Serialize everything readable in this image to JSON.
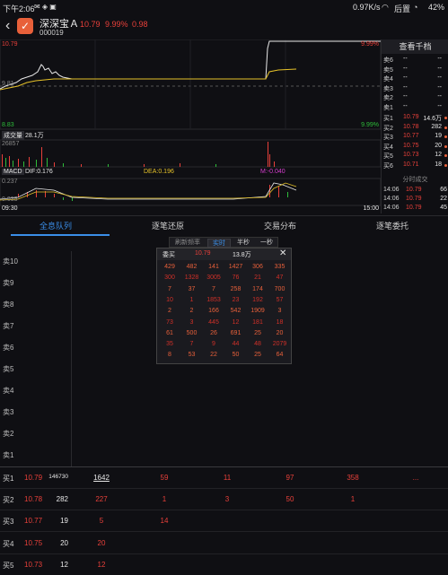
{
  "status_bar": {
    "time": "下午2:06",
    "speed": "0.97K/s",
    "carrier": "后置",
    "battery": "42%"
  },
  "header": {
    "stock_name": "深深宝Ａ",
    "stock_code": "000019",
    "price": "10.79",
    "change_pct": "9.99%",
    "change": "0.98"
  },
  "chart": {
    "price_high": "10.79",
    "pct_high": "9.99%",
    "price_mid": "9.81",
    "price_low": "8.83",
    "pct_low": "9.99%",
    "volume_label": "成交量",
    "volume_value": "28.1万",
    "volume_max": "26857",
    "macd_label": "MACD",
    "dif": "DIF:0.176",
    "dea": "DEA:0.196",
    "m": "M:-0.040",
    "macd_top": "0.237",
    "macd_bottom": "0.035",
    "time_start": "09:30",
    "time_end": "15:00"
  },
  "order_book": {
    "title": "查看千档",
    "sells": [
      {
        "label": "卖6",
        "price": "--",
        "vol": "--"
      },
      {
        "label": "卖5",
        "price": "--",
        "vol": "--"
      },
      {
        "label": "卖4",
        "price": "--",
        "vol": "--"
      },
      {
        "label": "卖3",
        "price": "--",
        "vol": "--"
      },
      {
        "label": "卖2",
        "price": "--",
        "vol": "--"
      },
      {
        "label": "卖1",
        "price": "--",
        "vol": "--"
      }
    ],
    "buys": [
      {
        "label": "买1",
        "price": "10.79",
        "vol": "14.6万"
      },
      {
        "label": "买2",
        "price": "10.78",
        "vol": "282"
      },
      {
        "label": "买3",
        "price": "10.77",
        "vol": "19"
      },
      {
        "label": "买4",
        "price": "10.75",
        "vol": "20"
      },
      {
        "label": "买5",
        "price": "10.73",
        "vol": "12"
      },
      {
        "label": "买6",
        "price": "10.71",
        "vol": "18"
      }
    ],
    "trades_title": "分时成交",
    "trades": [
      {
        "time": "14:06",
        "price": "10.79",
        "vol": "66"
      },
      {
        "time": "14:06",
        "price": "10.79",
        "vol": "22"
      },
      {
        "time": "14:06",
        "price": "10.79",
        "vol": "45"
      }
    ]
  },
  "tabs": [
    "全息队列",
    "逐笔还原",
    "交易分布",
    "逐笔委托"
  ],
  "freq": {
    "label": "刷新频率",
    "options": [
      "实时",
      "半秒",
      "一秒"
    ]
  },
  "popup": {
    "side": "委买",
    "price": "10.79",
    "total": "13.8万",
    "rows": [
      [
        "429",
        "482",
        "141",
        "1427",
        "306",
        "335"
      ],
      [
        "300",
        "1328",
        "3005",
        "76",
        "21",
        "47"
      ],
      [
        "7",
        "37",
        "7",
        "258",
        "174",
        "700"
      ],
      [
        "10",
        "1",
        "1853",
        "23",
        "192",
        "57"
      ],
      [
        "2",
        "2",
        "166",
        "542",
        "1909",
        "3"
      ],
      [
        "73",
        "3",
        "445",
        "12",
        "181",
        "18"
      ],
      [
        "61",
        "500",
        "26",
        "691",
        "25",
        "20"
      ],
      [
        "35",
        "7",
        "9",
        "44",
        "48",
        "2079"
      ],
      [
        "8",
        "53",
        "22",
        "50",
        "25",
        "64"
      ]
    ]
  },
  "queue_labels": [
    "卖10",
    "卖9",
    "卖8",
    "卖7",
    "卖6",
    "卖5",
    "卖4",
    "卖3",
    "卖2",
    "卖1"
  ],
  "buy_rows": [
    {
      "label": "买1",
      "price": "10.79",
      "vol": "146730",
      "queue": [
        "1642",
        "59",
        "11",
        "97",
        "358",
        "..."
      ]
    },
    {
      "label": "买2",
      "price": "10.78",
      "vol": "282",
      "queue": [
        "227",
        "1",
        "3",
        "50",
        "1"
      ]
    },
    {
      "label": "买3",
      "price": "10.77",
      "vol": "19",
      "queue": [
        "5",
        "14"
      ]
    },
    {
      "label": "买4",
      "price": "10.75",
      "vol": "20",
      "queue": [
        "20"
      ]
    },
    {
      "label": "买5",
      "price": "10.73",
      "vol": "12",
      "queue": [
        "12"
      ]
    }
  ],
  "colors": {
    "up": "#e8403a",
    "down": "#2ebd3a",
    "accent": "#3a8ee8",
    "line": "#e6c229"
  }
}
